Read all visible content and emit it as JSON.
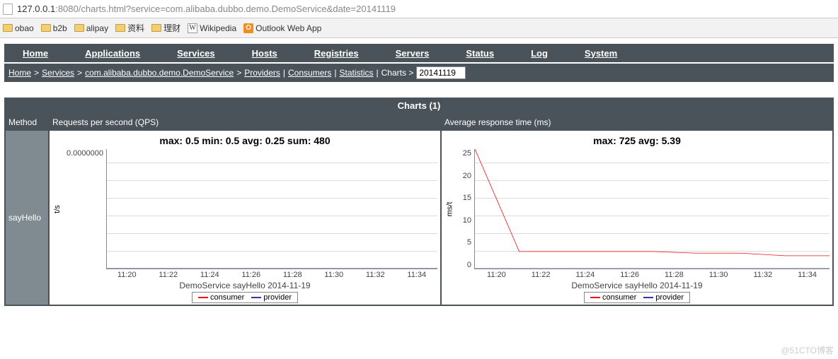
{
  "browser": {
    "host": "127.0.0.1",
    "port_path": ":8080/charts.html?service=com.alibaba.dubbo.demo.DemoService&date=20141119",
    "bookmarks": [
      {
        "label": "obao",
        "icon": "folder"
      },
      {
        "label": "b2b",
        "icon": "folder"
      },
      {
        "label": "alipay",
        "icon": "folder"
      },
      {
        "label": "资料",
        "icon": "folder"
      },
      {
        "label": "理财",
        "icon": "folder"
      },
      {
        "label": "Wikipedia",
        "icon": "w"
      },
      {
        "label": "Outlook Web App",
        "icon": "o"
      }
    ]
  },
  "nav": [
    "Home",
    "Applications",
    "Services",
    "Hosts",
    "Registries",
    "Servers",
    "Status",
    "Log",
    "System"
  ],
  "breadcrumb": {
    "items": [
      "Home",
      "Services",
      "com.alibaba.dubbo.demo.DemoService",
      "Providers",
      "Consumers",
      "Statistics"
    ],
    "current": "Charts",
    "date_value": "20141119"
  },
  "section_title": "Charts (1)",
  "columns": {
    "method": "Method",
    "qps": "Requests per second (QPS)",
    "rt": "Average response time (ms)"
  },
  "row": {
    "method": "sayHello"
  },
  "watermark_source": "@51CTO博客",
  "chart_data": [
    {
      "type": "line",
      "title": "max: 0.5 min: 0.5 avg: 0.25 sum: 480",
      "ylabel": "t/s",
      "yticks": [
        "0.0000000"
      ],
      "ylim": [
        0,
        1e-07
      ],
      "xticks": [
        "11:20",
        "11:22",
        "11:24",
        "11:26",
        "11:28",
        "11:30",
        "11:32",
        "11:34"
      ],
      "caption": "DemoService sayHello 2014-11-19",
      "series": [
        {
          "name": "consumer",
          "color": "#e11",
          "values": [
            0,
            0,
            0,
            0,
            0,
            0,
            0,
            0
          ]
        },
        {
          "name": "provider",
          "color": "#33a",
          "values": [
            0,
            0,
            0,
            0,
            0,
            0,
            0,
            0
          ]
        }
      ]
    },
    {
      "type": "line",
      "title": "max: 725 avg: 5.39",
      "ylabel": "ms/t",
      "yticks": [
        "25",
        "20",
        "15",
        "10",
        "5",
        "0"
      ],
      "ylim": [
        0,
        28
      ],
      "xticks": [
        "11:20",
        "11:22",
        "11:24",
        "11:26",
        "11:28",
        "11:30",
        "11:32",
        "11:34"
      ],
      "caption": "DemoService sayHello 2014-11-19",
      "series": [
        {
          "name": "consumer",
          "color": "#e11",
          "values": [
            28,
            4,
            4,
            4,
            4,
            3.6,
            3.6,
            3,
            3
          ]
        },
        {
          "name": "provider",
          "color": "#33a",
          "values": [
            0,
            0,
            0,
            0,
            0,
            0,
            0,
            0,
            0
          ]
        }
      ]
    }
  ]
}
